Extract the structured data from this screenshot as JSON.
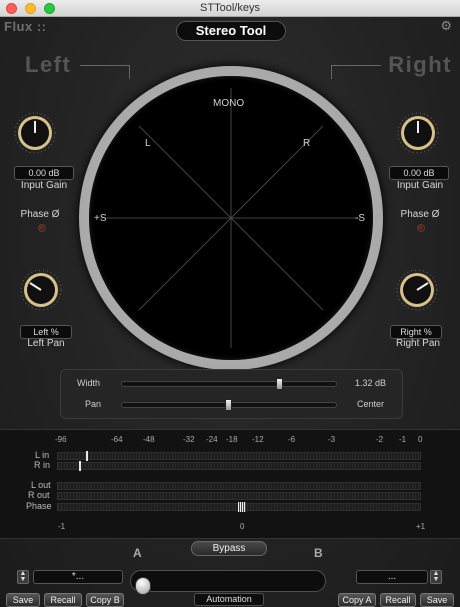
{
  "window": {
    "title": "STTool/keys"
  },
  "header": {
    "brand": "Flux ::",
    "plugin_title": "Stereo Tool",
    "settings_icon": "gear-icon"
  },
  "left": {
    "label": "Left",
    "input_gain_value": "0.00 dB",
    "input_gain_caption": "Input Gain",
    "phase_caption": "Phase Ø",
    "pan_value": "Left %",
    "pan_caption": "Left Pan"
  },
  "right": {
    "label": "Right",
    "input_gain_value": "0.00 dB",
    "input_gain_caption": "Input Gain",
    "phase_caption": "Phase Ø",
    "pan_value": "Right %",
    "pan_caption": "Right Pan"
  },
  "scope": {
    "top": "MONO",
    "upper_left": "L",
    "upper_right": "R",
    "left": "+S",
    "right": "-S"
  },
  "width_panel": {
    "width_label": "Width",
    "width_value": "1.32 dB",
    "width_position": 0.74,
    "pan_label": "Pan",
    "pan_value": "Center",
    "pan_position": 0.5
  },
  "meters": {
    "db_scale": [
      "-96",
      "-64",
      "-48",
      "-32",
      "-24",
      "-18",
      "-12",
      "-6",
      "-3",
      "-2",
      "-1",
      "0"
    ],
    "phase_scale": [
      "-1",
      "0",
      "+1"
    ],
    "rows": {
      "l_in": "L in",
      "r_in": "R in",
      "l_out": "L out",
      "r_out": "R out",
      "phase": "Phase"
    }
  },
  "bypass": {
    "label": "Bypass"
  },
  "automation": {
    "a_label": "A",
    "b_label": "B",
    "label": "Automation"
  },
  "presets": {
    "left_field": "*...",
    "right_field": "...",
    "buttons_left": [
      "Save",
      "Recall",
      "Copy B"
    ],
    "buttons_right": [
      "Copy A",
      "Recall",
      "Save"
    ]
  },
  "colors": {
    "accent_ring": "#d8c08a",
    "led_off": "#5a1a10",
    "meter_fill": "#e8e8e8"
  }
}
